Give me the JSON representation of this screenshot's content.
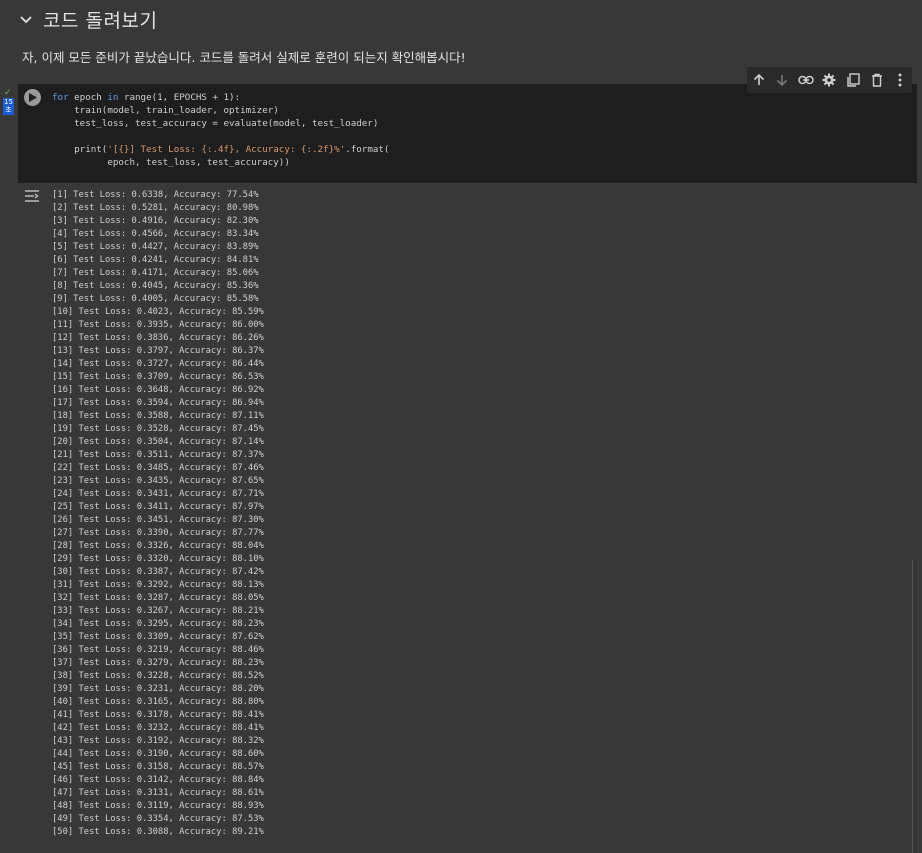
{
  "section": {
    "title": "코드 돌려보기"
  },
  "intro": {
    "text": "자, 이제 모든 준비가 끝났습니다. 코드를 돌려서 실제로 훈련이 되는지 확인해봅시다!"
  },
  "cell": {
    "execution_status": "✓",
    "execution_count": "15",
    "execution_unit": "초",
    "code": {
      "l1_kw1": "for",
      "l1_a": " epoch ",
      "l1_kw2": "in",
      "l1_b": " range(1, EPOCHS + 1):",
      "l2": "    train(model, train_loader, optimizer)",
      "l3": "    test_loss, test_accuracy = evaluate(model, test_loader)",
      "l5_a": "    print(",
      "l5_str": "'[{}] Test Loss: {:.4f}, Accuracy: {:.2f}%'",
      "l5_b": ".format(",
      "l6": "          epoch, test_loss, test_accuracy))"
    }
  },
  "toolbar": {
    "icons": [
      "arrow-up-icon",
      "arrow-down-icon",
      "link-icon",
      "gear-icon",
      "mirror-cell-icon",
      "trash-icon",
      "more-vert-icon"
    ]
  },
  "output": {
    "lines": [
      "[1] Test Loss: 0.6338, Accuracy: 77.54%",
      "[2] Test Loss: 0.5281, Accuracy: 80.98%",
      "[3] Test Loss: 0.4916, Accuracy: 82.30%",
      "[4] Test Loss: 0.4566, Accuracy: 83.34%",
      "[5] Test Loss: 0.4427, Accuracy: 83.89%",
      "[6] Test Loss: 0.4241, Accuracy: 84.81%",
      "[7] Test Loss: 0.4171, Accuracy: 85.06%",
      "[8] Test Loss: 0.4045, Accuracy: 85.36%",
      "[9] Test Loss: 0.4005, Accuracy: 85.58%",
      "[10] Test Loss: 0.4023, Accuracy: 85.59%",
      "[11] Test Loss: 0.3935, Accuracy: 86.00%",
      "[12] Test Loss: 0.3836, Accuracy: 86.26%",
      "[13] Test Loss: 0.3797, Accuracy: 86.37%",
      "[14] Test Loss: 0.3727, Accuracy: 86.44%",
      "[15] Test Loss: 0.3709, Accuracy: 86.53%",
      "[16] Test Loss: 0.3648, Accuracy: 86.92%",
      "[17] Test Loss: 0.3594, Accuracy: 86.94%",
      "[18] Test Loss: 0.3588, Accuracy: 87.11%",
      "[19] Test Loss: 0.3528, Accuracy: 87.45%",
      "[20] Test Loss: 0.3504, Accuracy: 87.14%",
      "[21] Test Loss: 0.3511, Accuracy: 87.37%",
      "[22] Test Loss: 0.3485, Accuracy: 87.46%",
      "[23] Test Loss: 0.3435, Accuracy: 87.65%",
      "[24] Test Loss: 0.3431, Accuracy: 87.71%",
      "[25] Test Loss: 0.3411, Accuracy: 87.97%",
      "[26] Test Loss: 0.3451, Accuracy: 87.30%",
      "[27] Test Loss: 0.3390, Accuracy: 87.77%",
      "[28] Test Loss: 0.3326, Accuracy: 88.04%",
      "[29] Test Loss: 0.3320, Accuracy: 88.10%",
      "[30] Test Loss: 0.3387, Accuracy: 87.42%",
      "[31] Test Loss: 0.3292, Accuracy: 88.13%",
      "[32] Test Loss: 0.3287, Accuracy: 88.05%",
      "[33] Test Loss: 0.3267, Accuracy: 88.21%",
      "[34] Test Loss: 0.3295, Accuracy: 88.23%",
      "[35] Test Loss: 0.3309, Accuracy: 87.62%",
      "[36] Test Loss: 0.3219, Accuracy: 88.46%",
      "[37] Test Loss: 0.3279, Accuracy: 88.23%",
      "[38] Test Loss: 0.3228, Accuracy: 88.52%",
      "[39] Test Loss: 0.3231, Accuracy: 88.20%",
      "[40] Test Loss: 0.3165, Accuracy: 88.80%",
      "[41] Test Loss: 0.3178, Accuracy: 88.41%",
      "[42] Test Loss: 0.3232, Accuracy: 88.41%",
      "[43] Test Loss: 0.3192, Accuracy: 88.32%",
      "[44] Test Loss: 0.3190, Accuracy: 88.60%",
      "[45] Test Loss: 0.3158, Accuracy: 88.57%",
      "[46] Test Loss: 0.3142, Accuracy: 88.84%",
      "[47] Test Loss: 0.3131, Accuracy: 88.61%",
      "[48] Test Loss: 0.3119, Accuracy: 88.93%",
      "[49] Test Loss: 0.3354, Accuracy: 87.53%",
      "[50] Test Loss: 0.3088, Accuracy: 89.21%"
    ]
  }
}
